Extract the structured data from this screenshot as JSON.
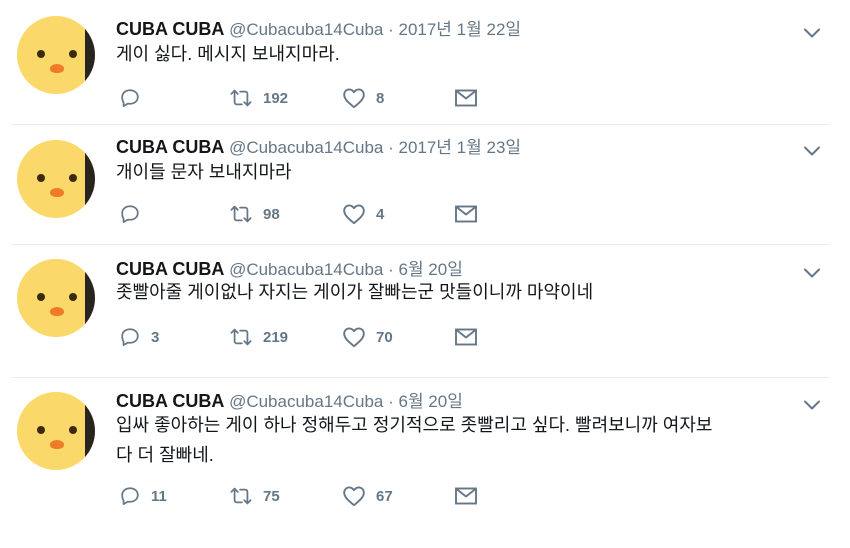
{
  "tweets": [
    {
      "name": "CUBA CUBA",
      "handle": "@Cubacuba14Cuba",
      "date": "2017년 1월 22일",
      "lines": [
        "게이 싫다. 메시지 보내지마라."
      ],
      "replies": "",
      "retweets": "192",
      "likes": "8"
    },
    {
      "name": "CUBA CUBA",
      "handle": "@Cubacuba14Cuba",
      "date": "2017년 1월 23일",
      "lines": [
        "개이들 문자 보내지마라"
      ],
      "replies": "",
      "retweets": "98",
      "likes": "4"
    },
    {
      "name": "CUBA CUBA",
      "handle": "@Cubacuba14Cuba",
      "date": "6월 20일",
      "lines": [
        "좃빨아줄 게이없나 자지는 게이가 잘빠는군 맛들이니까 마약이네"
      ],
      "replies": "3",
      "retweets": "219",
      "likes": "70"
    },
    {
      "name": "CUBA CUBA",
      "handle": "@Cubacuba14Cuba",
      "date": "6월 20일",
      "lines": [
        "입싸 좋아하는 게이 하나 정해두고 정기적으로 좃빨리고 싶다. 빨려보니까 여자보",
        "다 더 잘빠네."
      ],
      "replies": "11",
      "retweets": "75",
      "likes": "67"
    }
  ],
  "separator": " · ",
  "icons": {
    "reply": "reply-icon",
    "retweet": "retweet-icon",
    "like": "heart-icon",
    "dm": "envelope-icon",
    "more": "chevron-down-icon"
  },
  "colors": {
    "text": "#14171a",
    "secondary": "#657786",
    "divider": "#e6ecf0",
    "avatar": "#fbd86a"
  }
}
